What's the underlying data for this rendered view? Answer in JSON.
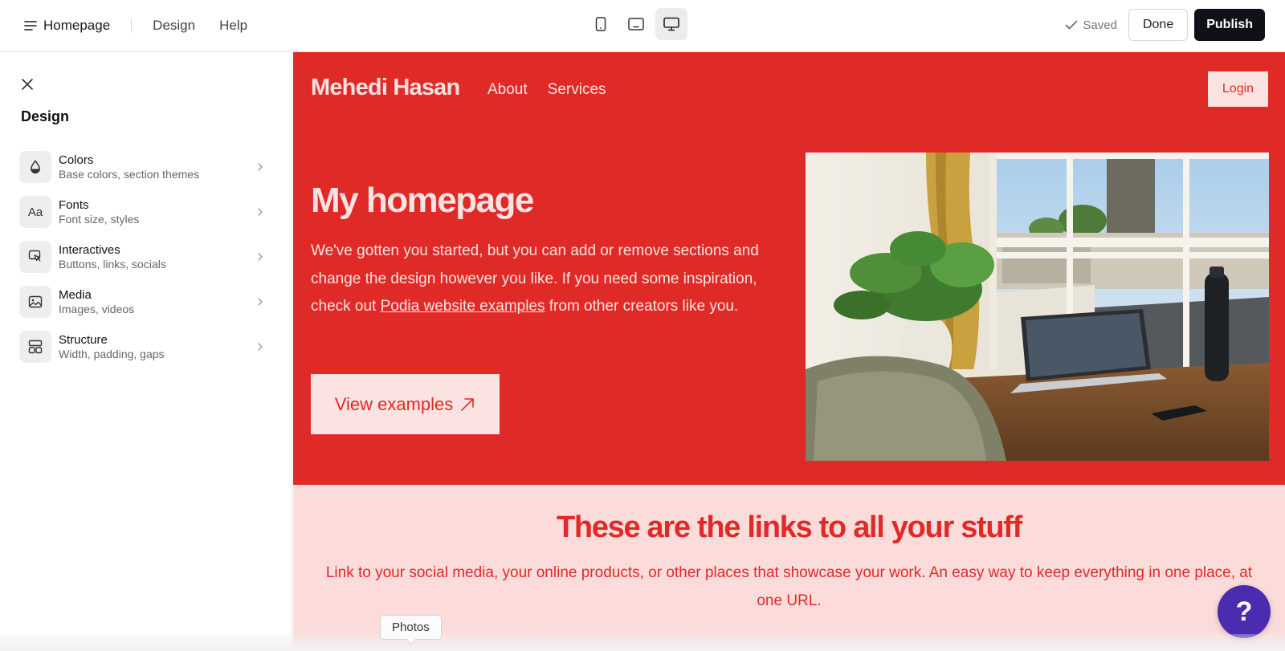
{
  "topbar": {
    "page_name": "Homepage",
    "nav": [
      "Design",
      "Help"
    ],
    "saved_label": "Saved",
    "done_label": "Done",
    "publish_label": "Publish"
  },
  "sidebar": {
    "title": "Design",
    "items": [
      {
        "label": "Colors",
        "sub": "Base colors, section themes",
        "icon": "drop-icon"
      },
      {
        "label": "Fonts",
        "sub": "Font size, styles",
        "icon": "fonts-icon",
        "glyph": "Aa"
      },
      {
        "label": "Interactives",
        "sub": "Buttons, links, socials",
        "icon": "cursor-click-icon"
      },
      {
        "label": "Media",
        "sub": "Images, videos",
        "icon": "image-icon"
      },
      {
        "label": "Structure",
        "sub": "Width, padding, gaps",
        "icon": "layout-icon"
      }
    ]
  },
  "site": {
    "brand": "Mehedi Hasan",
    "nav": [
      "About",
      "Services"
    ],
    "login_label": "Login",
    "hero_title": "My homepage",
    "hero_body_before": "We've gotten you started, but you can add or remove sections and change the design however you like. If you need some inspiration, check out ",
    "hero_body_link": "Podia website examples",
    "hero_body_after": " from other creators like you.",
    "cta_label": "View examples",
    "links_title": "These are the links to all your stuff",
    "links_body": "Link to your social media, your online products, or other places that showcase your work. An easy way to keep everything in one place, at one URL."
  },
  "tooltip": "Photos",
  "help_glyph": "?",
  "colors": {
    "brand_red": "#e02a27",
    "brand_pink": "#fbe3e1",
    "section_pink": "#fbdcdb",
    "help_purple": "#4b2bb0",
    "publish_black": "#0e1217"
  }
}
